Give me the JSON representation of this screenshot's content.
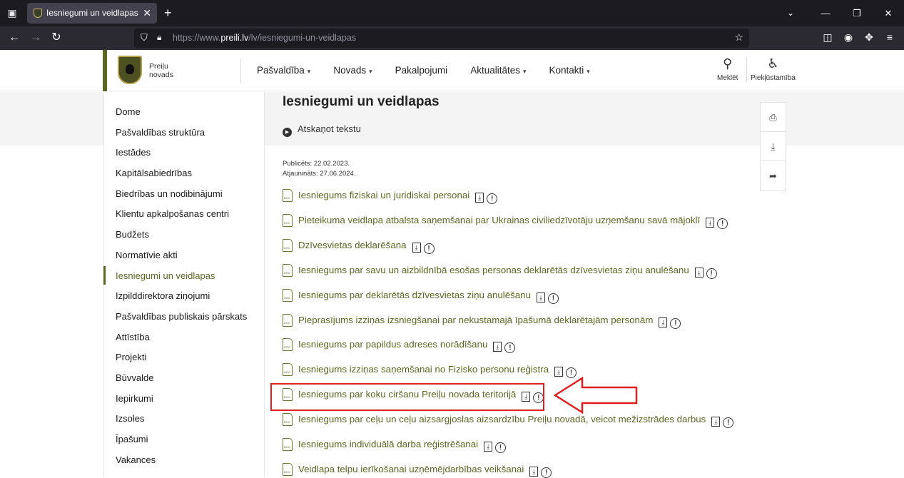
{
  "browser": {
    "tab_title": "Iesniegumi un veidlapas | Preiļi",
    "tab_close": "✕",
    "new_tab": "+",
    "url_domain": "preili.lv",
    "url_prefix": "https://www.",
    "url_path": "/lv/iesniegumi-un-veidlapas"
  },
  "site": {
    "logo_line1": "Preiļu",
    "logo_line2": "novads",
    "nav": [
      {
        "label": "Pašvaldība",
        "dropdown": true
      },
      {
        "label": "Novads",
        "dropdown": true
      },
      {
        "label": "Pakalpojumi",
        "dropdown": false
      },
      {
        "label": "Aktualitātes",
        "dropdown": true
      },
      {
        "label": "Kontakti",
        "dropdown": true
      }
    ],
    "search_label": "Meklēt",
    "accessibility_label": "Piekļūstamība"
  },
  "sidebar": {
    "items": [
      "Dome",
      "Pašvaldības struktūra",
      "Iestādes",
      "Kapitālsabiedrības",
      "Biedrības un nodibinājumi",
      "Klientu apkalpošanas centri",
      "Budžets",
      "Normatīvie akti",
      "Iesniegumi un veidlapas",
      "Izpilddirektora ziņojumi",
      "Pašvaldības publiskais pārskats",
      "Attīstība",
      "Projekti",
      "Būvvalde",
      "Iepirkumi",
      "Izsoles",
      "Īpašumi",
      "Vakances"
    ],
    "active_index": 8
  },
  "main": {
    "title": "Iesniegumi un veidlapas",
    "listen_label": "Atskaņot tekstu",
    "published": "Publicēts: 22.02.2023.",
    "updated": "Atjaunināts: 27.06.2024.",
    "documents": [
      "Iesniegums fiziskai un juridiskai personai",
      "Pieteikuma veidlapa atbalsta saņemšanai par Ukrainas civiliedzīvotāju uzņemšanu savā mājoklī",
      "Dzīvesvietas deklarēšana",
      "Iesniegums par savu un aizbildnībā esošas personas deklarētās dzīvesvietas ziņu anulēšanu",
      "Iesniegums par deklarētās dzīvesvietas ziņu anulēšanu",
      "Pieprasījums izziņas izsniegšanai par nekustamajā īpašumā deklarētajām personām",
      "Iesniegums par papildus adreses norādīšanu",
      "Iesniegums izziņas saņemšanai no Fizisko personu reģistra",
      "Iesniegums par koku ciršanu Preiļu novada teritorijā",
      "Iesniegums par ceļu un ceļu aizsargjoslas aizsardzību Preiļu novadā, veicot mežizstrādes darbus",
      "Iesniegums individuālā darba reģistrēšanai",
      "Veidlapa telpu ierīkošanai uzņēmējdarbības veikšanai"
    ],
    "highlighted_index": 8
  },
  "colors": {
    "brand_green": "#5d6620",
    "highlight_red": "#e02020"
  }
}
